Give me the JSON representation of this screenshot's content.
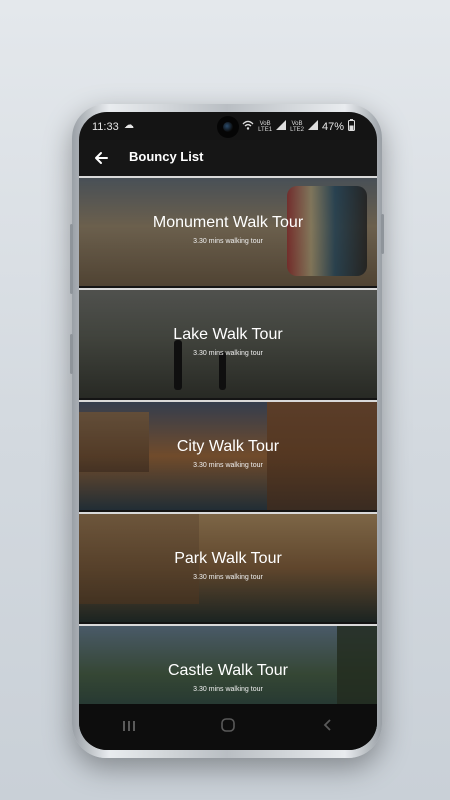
{
  "status_bar": {
    "time": "11:33",
    "cloud_icon": "cloud-icon",
    "net1": "VoB\nLTE1",
    "net2": "VoB\nLTE2",
    "battery": "47%"
  },
  "app_bar": {
    "title": "Bouncy List",
    "back_icon": "arrow-left-icon"
  },
  "tours": [
    {
      "title": "Monument Walk Tour",
      "subtitle": "3.30 mins walking tour"
    },
    {
      "title": "Lake Walk Tour",
      "subtitle": "3.30 mins walking tour"
    },
    {
      "title": "City Walk Tour",
      "subtitle": "3.30 mins walking tour"
    },
    {
      "title": "Park Walk Tour",
      "subtitle": "3.30 mins walking tour"
    },
    {
      "title": "Castle Walk Tour",
      "subtitle": "3.30 mins walking tour"
    }
  ],
  "nav_bar": {
    "recent_icon": "recent-apps-icon",
    "home_icon": "home-icon",
    "back_icon": "back-icon"
  },
  "colors": {
    "app_bar_bg": "#161616",
    "screen_bg": "#141414",
    "text": "#ffffff"
  }
}
